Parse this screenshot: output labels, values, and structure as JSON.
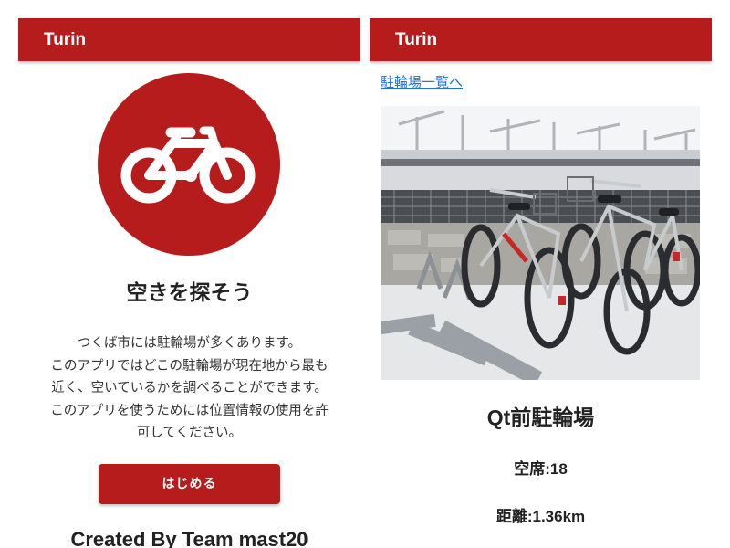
{
  "colors": {
    "brand_red": "#b71c1c",
    "link_blue": "#1a73e8",
    "text_dark": "#222222"
  },
  "left_screen": {
    "app_title": "Turin",
    "logo_icon": "bicycle-icon",
    "hero_title": "空きを探そう",
    "description_lines": [
      "つくば市には駐輪場が多くあります。",
      "このアプリではどこの駐輪場が現在地から最も",
      "近く、空いているかを調べることができます。",
      "このアプリを使うためには位置情報の使用を許",
      "可してください。"
    ],
    "start_button": "はじめる",
    "credit": "Created By Team mast20"
  },
  "right_screen": {
    "app_title": "Turin",
    "back_link": "駐輪場一覧へ",
    "photo_subject": "bicycle parking rack photo",
    "station_name": "Qt前駐輪場",
    "vacancy": "空席:18",
    "distance": "距離:1.36km"
  }
}
